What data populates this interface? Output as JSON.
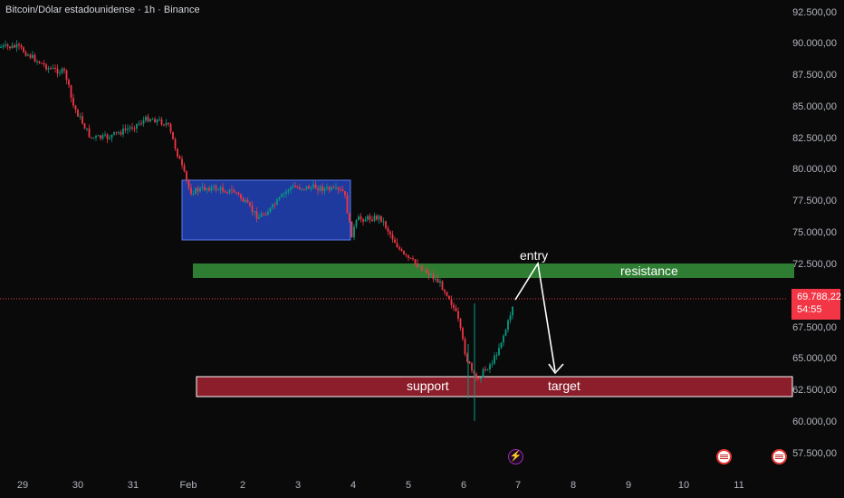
{
  "header": {
    "title": "Bitcoin/Dólar estadounidense · 1h · Binance"
  },
  "price_axis": {
    "ticks": [
      "92.500,00",
      "90.000,00",
      "87.500,00",
      "85.000,00",
      "82.500,00",
      "80.000,00",
      "77.500,00",
      "75.000,00",
      "72.500,00",
      "67.500,00",
      "65.000,00",
      "62.500,00",
      "60.000,00",
      "57.500,00"
    ],
    "current_price": "69.788,22",
    "countdown": "54:55"
  },
  "time_axis": {
    "ticks": [
      "29",
      "30",
      "31",
      "Feb",
      "2",
      "3",
      "4",
      "5",
      "6",
      "7",
      "8",
      "9",
      "10",
      "11"
    ]
  },
  "annotations": {
    "entry": "entry",
    "resistance": "resistance",
    "support": "support",
    "target": "target"
  },
  "events": [
    {
      "icon": "lightning-bolt-icon",
      "glyph": "⚡"
    },
    {
      "icon": "us-flag-icon"
    },
    {
      "icon": "us-flag-icon"
    }
  ],
  "colors": {
    "up": "#089981",
    "down": "#f23645",
    "resistance_zone": "#2e7d32",
    "support_zone": "#8b1e2a",
    "range_box": "#1e3a9e",
    "price_line": "#f23645"
  },
  "chart_data": {
    "type": "candlestick",
    "title": "Bitcoin/Dólar estadounidense · 1h · Binance",
    "x": [
      "29",
      "30",
      "31",
      "Feb",
      "2",
      "3",
      "4",
      "5",
      "6",
      "7"
    ],
    "close": [
      89500,
      87000,
      84200,
      78500,
      77800,
      78300,
      76400,
      71000,
      63500,
      69788
    ],
    "ylim": [
      57500,
      92500
    ],
    "zones": {
      "resistance": [
        71500,
        72700
      ],
      "support": [
        62200,
        63800
      ],
      "range": [
        74800,
        79500
      ]
    },
    "current_price": 69788.22
  }
}
